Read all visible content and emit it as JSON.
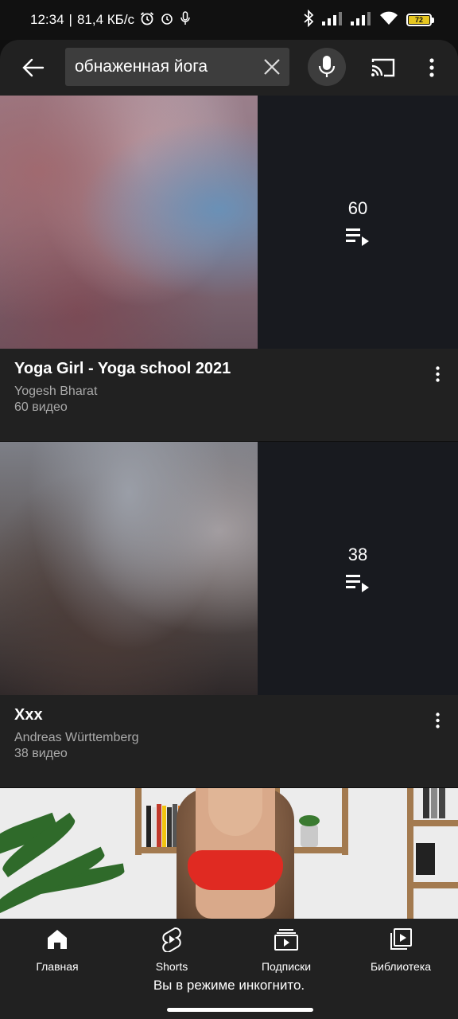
{
  "status_bar": {
    "time": "12:34",
    "separator": "|",
    "speed": "81,4 КБ/с",
    "battery_level": "72",
    "battery_color": "#e6c620"
  },
  "app_bar": {
    "search_query": "обнаженная йога",
    "icons": [
      "back-arrow-icon",
      "clear-icon",
      "microphone-icon",
      "cast-icon",
      "more-vert-icon"
    ]
  },
  "results": [
    {
      "title": "Yoga Girl - Yoga school 2021",
      "channel": "Yogesh Bharat",
      "video_count_label": "60 видео",
      "overlay_count": "60"
    },
    {
      "title": "Xxx",
      "channel": "Andreas Württemberg",
      "video_count_label": "38 видео",
      "overlay_count": "38"
    }
  ],
  "bottom_nav": {
    "items": [
      {
        "label": "Главная",
        "icon": "home-icon"
      },
      {
        "label": "Shorts",
        "icon": "shorts-icon"
      },
      {
        "label": "Подписки",
        "icon": "subscriptions-icon"
      },
      {
        "label": "Библиотека",
        "icon": "library-icon"
      }
    ],
    "incognito_message": "Вы в режиме инкогнито."
  },
  "colors": {
    "background": "#0f0f0f",
    "surface": "#212121",
    "search_field": "#3d3d3d",
    "secondary_text": "#aaaaaa"
  }
}
